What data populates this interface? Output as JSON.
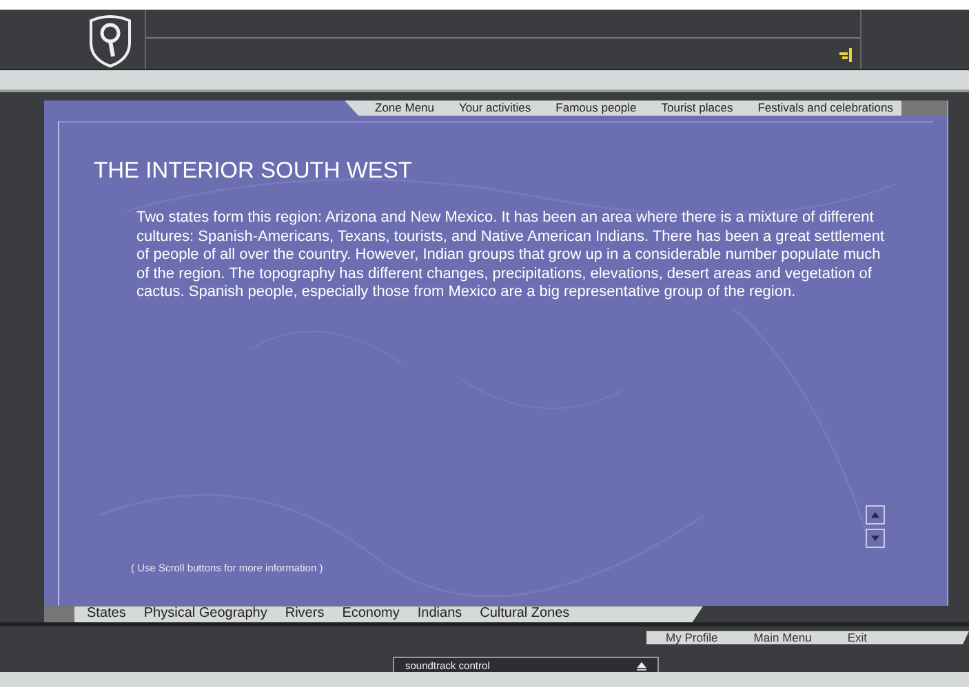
{
  "top_menu": [
    {
      "label": "Zone Menu"
    },
    {
      "label": "Your activities"
    },
    {
      "label": "Famous people"
    },
    {
      "label": "Tourist places"
    },
    {
      "label": "Festivals and celebrations"
    }
  ],
  "title": "THE INTERIOR SOUTH WEST",
  "body": "Two states form this region: Arizona and New Mexico. It has been an area where there is a mixture of different cultures: Spanish-Americans, Texans, tourists, and Native American Indians. There has been a great settlement of people of all over the country. However, Indian groups that grow up in a considerable number populate much of the region. The topography has different changes, precipitations, elevations, desert areas and vegetation of cactus. Spanish people, especially those from Mexico are a big representative group of the region.",
  "hint": "( Use Scroll buttons for more information )",
  "bottom_menu": [
    {
      "label": "States"
    },
    {
      "label": "Physical Geography"
    },
    {
      "label": "Rivers"
    },
    {
      "label": "Economy"
    },
    {
      "label": "Indians"
    },
    {
      "label": "Cultural Zones"
    }
  ],
  "soundtrack": {
    "label": "soundtrack control"
  },
  "footer_links": [
    {
      "label": "My Profile"
    },
    {
      "label": "Main Menu"
    },
    {
      "label": "Exit"
    }
  ]
}
